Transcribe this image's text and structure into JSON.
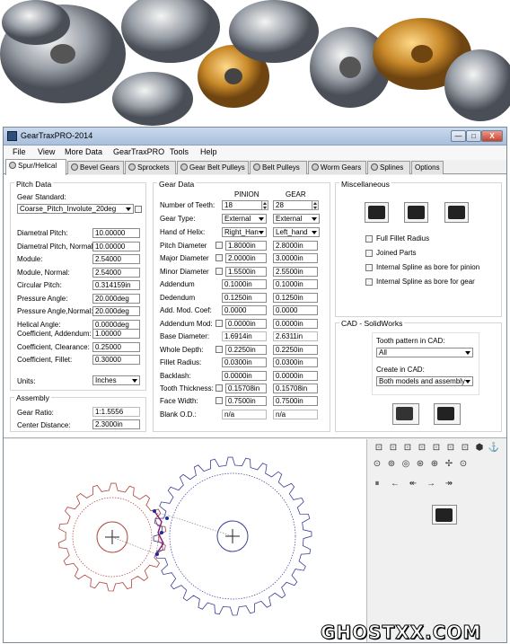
{
  "window": {
    "title": "GearTraxPRO-2014",
    "icon": "geartrax-app-icon",
    "controls": {
      "minimize": "—",
      "maximize": "□",
      "close": "X"
    }
  },
  "menu": [
    "File",
    "View",
    "More Data",
    "GearTraxPRO",
    "Tools",
    "Help"
  ],
  "tabs": [
    "Spur/Helical",
    "Bevel Gears",
    "Sprockets",
    "Gear Belt Pulleys",
    "Belt Pulleys",
    "Worm Gears",
    "Splines",
    "Options"
  ],
  "pitch": {
    "title": "Pitch Data",
    "standard_label": "Gear Standard:",
    "standard_value": "Coarse_Pitch_Involute_20deg",
    "rows": [
      {
        "label": "Diametral Pitch:",
        "value": "10.00000"
      },
      {
        "label": "Diametral Pitch, Normal:",
        "value": "10.00000"
      },
      {
        "label": "Module:",
        "value": "2.54000"
      },
      {
        "label": "Module, Normal:",
        "value": "2.54000"
      },
      {
        "label": "Circular Pitch:",
        "value": "0.314159in"
      },
      {
        "label": "Pressure Angle:",
        "value": "20.000deg"
      },
      {
        "label": "Pressure Angle,Normal:",
        "value": "20.000deg"
      },
      {
        "label": "Helical Angle:",
        "value": "0.0000deg"
      }
    ],
    "coef": [
      {
        "label": "Coefficient, Addendum:",
        "value": "1.00000"
      },
      {
        "label": "Coefficient, Clearance:",
        "value": "0.25000"
      },
      {
        "label": "Coefficient, Fillet:",
        "value": "0.30000"
      }
    ],
    "units_label": "Units:",
    "units_value": "Inches"
  },
  "assembly": {
    "title": "Assembly",
    "ratio_label": "Gear Ratio:",
    "ratio_value": "1:1.5556",
    "center_label": "Center Distance:",
    "center_value": "2.3000in"
  },
  "gear": {
    "title": "Gear Data",
    "col_pinion": "PINION",
    "col_gear": "GEAR",
    "rows": [
      {
        "label": "Number of Teeth:",
        "pinion": "18",
        "gear": "28",
        "kind": "spin"
      },
      {
        "label": "Gear Type:",
        "pinion": "External",
        "gear": "External",
        "kind": "dd"
      },
      {
        "label": "Hand of Helix:",
        "pinion": "Right_Han",
        "gear": "Left_hand",
        "kind": "dd"
      },
      {
        "label": "Pitch Diameter",
        "pinion": "1.8000in",
        "gear": "2.8000in",
        "kind": "chk"
      },
      {
        "label": "Major Diameter",
        "pinion": "2.0000in",
        "gear": "3.0000in",
        "kind": "chk"
      },
      {
        "label": "Minor Diameter",
        "pinion": "1.5500in",
        "gear": "2.5500in",
        "kind": "chk"
      },
      {
        "label": "Addendum",
        "pinion": "0.1000in",
        "gear": "0.1000in",
        "kind": "plain"
      },
      {
        "label": "Dedendum",
        "pinion": "0.1250in",
        "gear": "0.1250in",
        "kind": "plain"
      },
      {
        "label": "Add. Mod. Coef:",
        "pinion": "0.0000",
        "gear": "0.0000",
        "kind": "plain"
      },
      {
        "label": "Addendum Mod:",
        "pinion": "0.0000in",
        "gear": "0.0000in",
        "kind": "chk"
      },
      {
        "label": "Base Diameter:",
        "pinion": "1.6914in",
        "gear": "2.6311in",
        "kind": "ro"
      },
      {
        "label": "Whole Depth:",
        "pinion": "0.2250in",
        "gear": "0.2250in",
        "kind": "chk"
      },
      {
        "label": "Fillet Radius:",
        "pinion": "0.0300in",
        "gear": "0.0300in",
        "kind": "plain"
      },
      {
        "label": "Backlash:",
        "pinion": "0.0000in",
        "gear": "0.0000in",
        "kind": "plain"
      },
      {
        "label": "Tooth Thickness:",
        "pinion": "0.15708in",
        "gear": "0.15708in",
        "kind": "chk"
      },
      {
        "label": "Face Width:",
        "pinion": "0.7500in",
        "gear": "0.7500in",
        "kind": "chk"
      },
      {
        "label": "Blank O.D.:",
        "pinion": "n/a",
        "gear": "n/a",
        "kind": "ro"
      }
    ]
  },
  "misc": {
    "title": "Miscellaneous",
    "buttons": [
      "gauge-icon",
      "balance-scale-icon",
      "caliper-icon"
    ],
    "options": [
      "Full Fillet Radius",
      "Joined Parts",
      "Internal Spline as bore for pinion",
      "Internal Spline as bore for gear"
    ]
  },
  "cad": {
    "title": "CAD - SolidWorks",
    "tooth_label": "Tooth pattern in CAD:",
    "tooth_value": "All",
    "create_label": "Create in CAD:",
    "create_value": "Both models and assembly",
    "buttons": [
      "table-icon",
      "export-cad-icon"
    ]
  },
  "toolbar": {
    "row1": [
      "⊡",
      "⊡",
      "⊡",
      "⊡",
      "⊡",
      "⊡",
      "⊡",
      "⬢",
      "⚓"
    ],
    "row2": [
      "⊙",
      "⊚",
      "◎",
      "⊛",
      "⊕",
      "✢",
      "⊙"
    ],
    "row3": [
      "⏸",
      "←",
      "↞",
      "→",
      "↠"
    ],
    "clipboard_icon": "clipboard-icon"
  },
  "colors": {
    "pinion": "#b0413e",
    "gear": "#3c3c96",
    "accent": "#2d4f7a"
  },
  "watermark": "GHOSTXX.COM"
}
